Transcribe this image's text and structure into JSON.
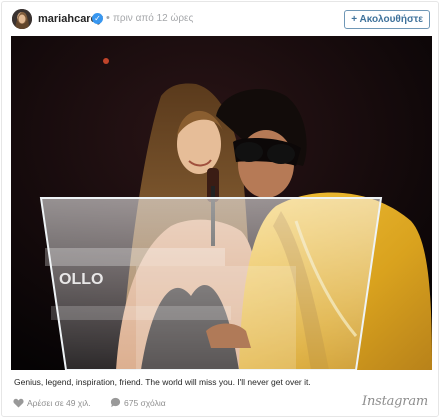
{
  "header": {
    "username": "mariahcarey",
    "timestamp": "πριν από 12 ώρες",
    "follow_label": "+ Ακολουθήστε"
  },
  "post": {
    "caption": "Genius, legend, inspiration, friend. The world will miss you. I'll never get over it.",
    "podium_text": "OLLO"
  },
  "footer": {
    "likes": "Αρέσει σε 49 χιλ.",
    "comments": "675 σχόλια",
    "brand": "Instagram"
  },
  "icons": {
    "verified": "verified-badge-icon",
    "like": "heart-icon",
    "comment": "speech-bubble-icon"
  },
  "colors": {
    "verified_blue": "#3897f0",
    "follow_text": "#3f729b",
    "follow_border": "#6f97b6",
    "muted_text": "#8e8e8e"
  }
}
